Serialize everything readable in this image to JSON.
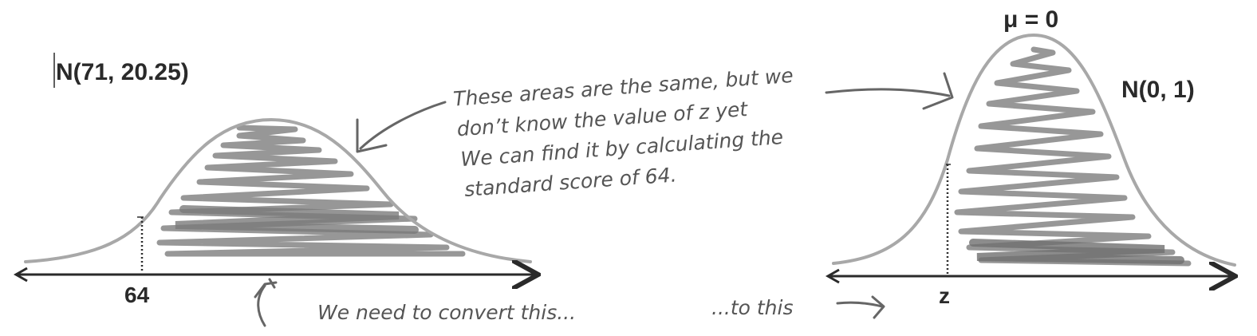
{
  "left_chart": {
    "title": "N(71, 20.25)",
    "tick_label": "64"
  },
  "right_chart": {
    "mean_label": "μ = 0",
    "title": "N(0, 1)",
    "tick_label": "z"
  },
  "annotations": {
    "areas_note": [
      "These areas are the same, but we",
      "don’t know the value of z yet",
      "We can find it by calculating the",
      "standard score of 64."
    ],
    "convert_note": "We need to convert this...",
    "to_this_note": "...to this"
  },
  "colors": {
    "ink": "#2a2a2a",
    "pencil": "#8c8c8c",
    "handwriting": "#555555"
  }
}
